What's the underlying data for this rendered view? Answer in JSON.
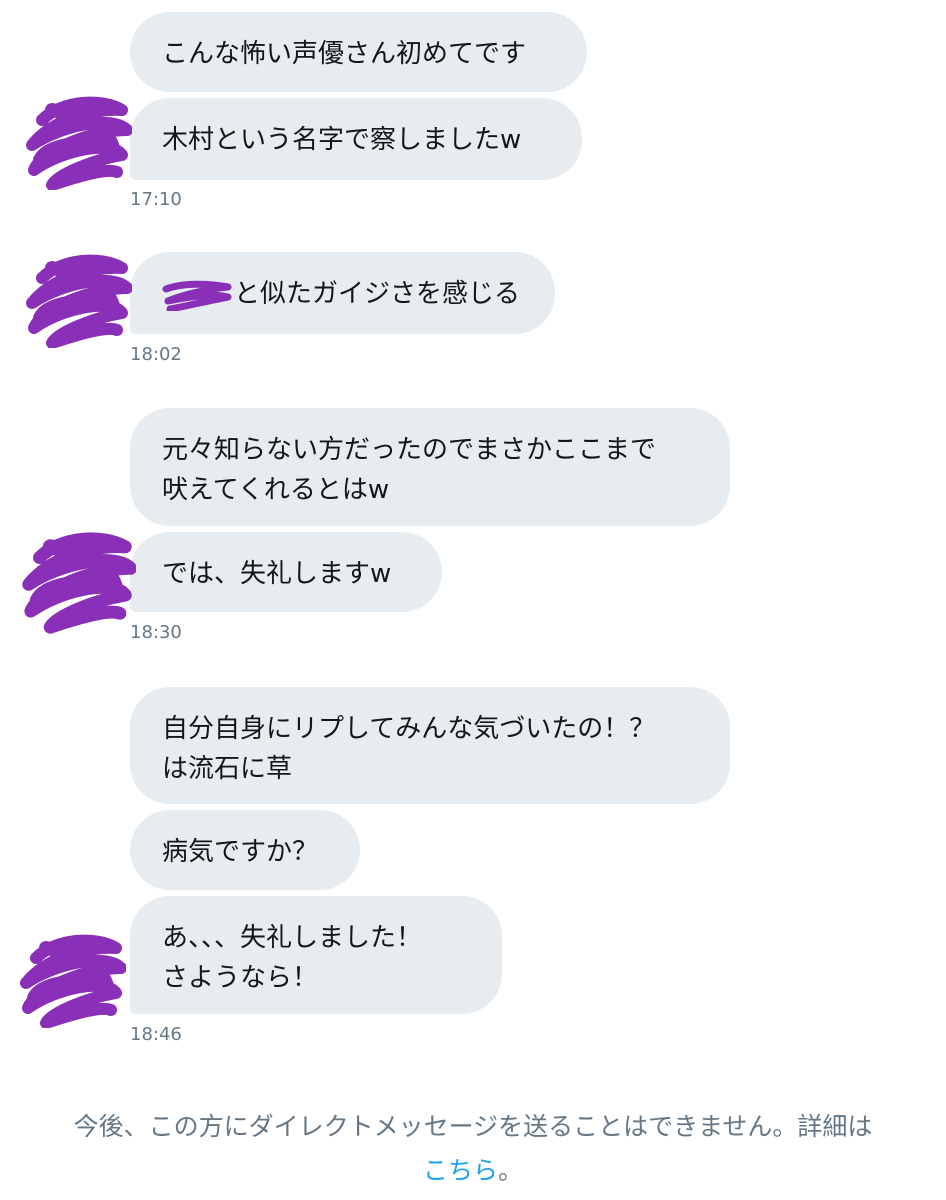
{
  "groups": [
    {
      "messages": [
        {
          "lines": [
            "こんな怖い声優さん初めてです"
          ]
        },
        {
          "lines": [
            "木村という名字で察しましたw"
          ]
        }
      ],
      "time": "17:10"
    },
    {
      "messages": [
        {
          "lines": [
            "と似たガイジさを感じる"
          ]
        }
      ],
      "time": "18:02"
    },
    {
      "messages": [
        {
          "lines": [
            "元々知らない方だったのでまさかここまで",
            "吠えてくれるとはw"
          ]
        },
        {
          "lines": [
            "では、失礼しますw"
          ]
        }
      ],
      "time": "18:30"
    },
    {
      "messages": [
        {
          "lines": [
            "自分自身にリプしてみんな気づいたの！？",
            "は流石に草"
          ]
        },
        {
          "lines": [
            "病気ですか？"
          ]
        },
        {
          "lines": [
            "あ、、、失礼しました！",
            "さようなら！"
          ]
        }
      ],
      "time": "18:46"
    }
  ],
  "notice": {
    "text_line1": "今後、この方にダイレクトメッセージを送ることはできません。詳細は",
    "link_label": "こちら",
    "text_end": "。"
  },
  "colors": {
    "bubble": "#e6ecf0",
    "timestamp": "#657786",
    "link": "#1da1f2",
    "redaction": "#8a2fb8"
  },
  "icons": {
    "avatar": "avatar-redacted-scribble",
    "inline_redaction": "redacted-name-scribble"
  }
}
